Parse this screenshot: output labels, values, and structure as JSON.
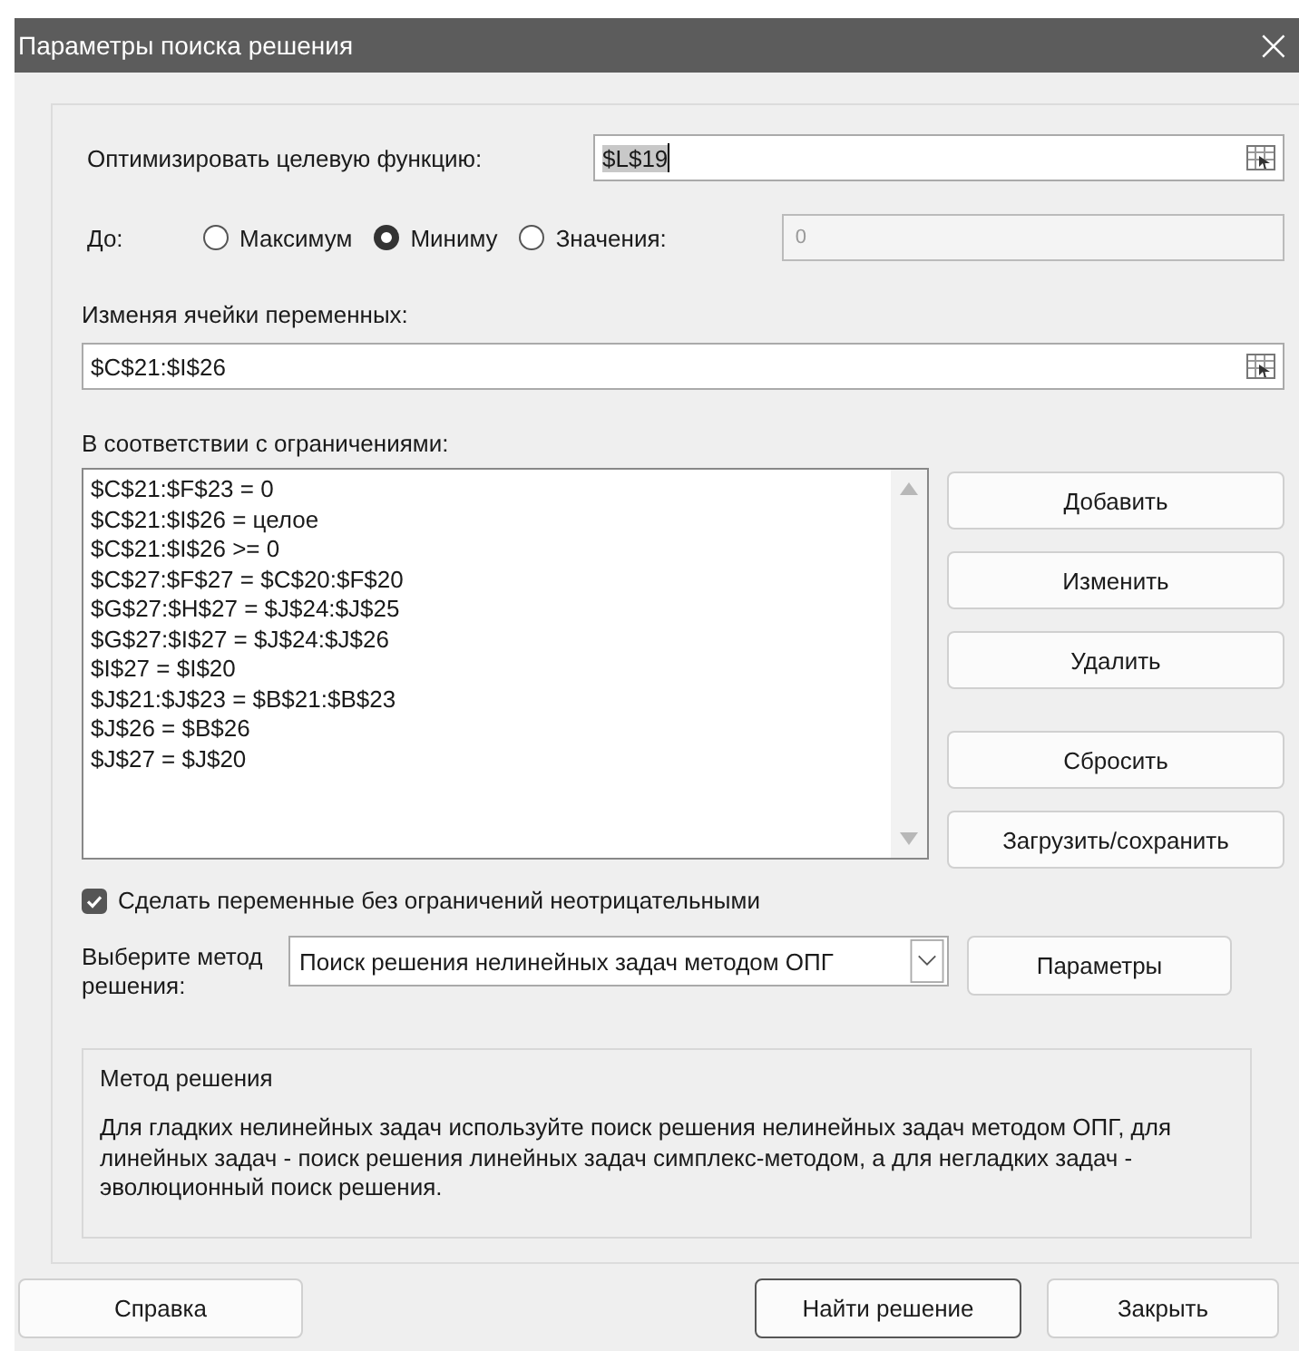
{
  "window": {
    "title": "Параметры поиска решения",
    "close": "×"
  },
  "objective": {
    "label": "Оптимизировать целевую функцию:",
    "value": "$L$19"
  },
  "to": {
    "label": "До:",
    "options": [
      {
        "label": "Максимум",
        "selected": false
      },
      {
        "label": "Миниму",
        "selected": true
      },
      {
        "label": "Значения:",
        "selected": false
      }
    ],
    "value": {
      "value": "0",
      "disabled": true
    }
  },
  "variables": {
    "label": "Изменяя ячейки переменных:",
    "value": "$C$21:$I$26"
  },
  "constraints": {
    "label": "В соответствии с ограничениями:",
    "items": [
      "$C$21:$F$23 = 0",
      "$C$21:$I$26 = целое",
      "$C$21:$I$26 >= 0",
      "$C$27:$F$27 = $C$20:$F$20",
      "$G$27:$H$27 = $J$24:$J$25",
      "$G$27:$I$27 = $J$24:$J$26",
      "$I$27 = $I$20",
      "$J$21:$J$23 = $B$21:$B$23",
      "$J$26 = $B$26",
      "$J$27 = $J$20"
    ],
    "buttons": [
      "Добавить",
      "Изменить",
      "Удалить",
      "Сбросить",
      "Загрузить/сохранить"
    ]
  },
  "nonnegative": {
    "label": "Сделать переменные без ограничений неотрицательными",
    "checked": true
  },
  "method": {
    "label": "Выберите метод решения:",
    "value": "Поиск решения нелинейных задач методом ОПГ",
    "button": "Параметры"
  },
  "method_info": {
    "title": "Метод решения",
    "text": "Для гладких нелинейных задач используйте поиск решения нелинейных задач методом ОПГ, для линейных задач - поиск решения линейных задач симплекс-методом, а для негладких задач - эволюционный поиск решения."
  },
  "footer_buttons": [
    {
      "label": "Справка",
      "kind": "plain"
    },
    {
      "label": "Найти решение",
      "kind": "default"
    },
    {
      "label": "Закрыть",
      "kind": "plain"
    }
  ]
}
